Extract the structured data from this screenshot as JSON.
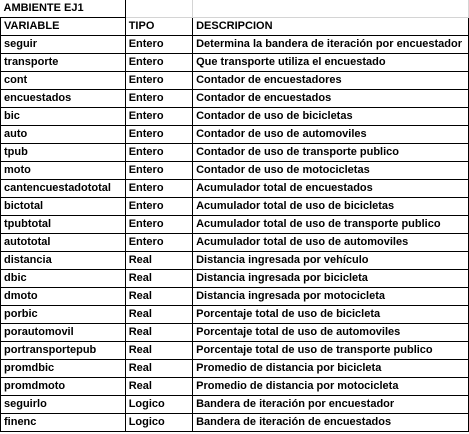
{
  "sheet": {
    "title": "AMBIENTE EJ1",
    "headers": [
      "VARIABLE",
      "TIPO",
      "DESCRIPCION"
    ],
    "rows": [
      [
        "seguir",
        "Entero",
        "Determina la bandera de iteración por encuestador"
      ],
      [
        "transporte",
        "Entero",
        "Que transporte utiliza el encuestado"
      ],
      [
        "cont",
        "Entero",
        "Contador de encuestadores"
      ],
      [
        "encuestados",
        "Entero",
        "Contador de encuestados"
      ],
      [
        "bic",
        "Entero",
        "Contador de uso de bicicletas"
      ],
      [
        "auto",
        "Entero",
        "Contador de uso de automoviles"
      ],
      [
        "tpub",
        "Entero",
        "Contador de uso de transporte publico"
      ],
      [
        "moto",
        "Entero",
        "Contador de uso de motocicletas"
      ],
      [
        "cantencuestadototal",
        "Entero",
        "Acumulador total de encuestados"
      ],
      [
        "bictotal",
        "Entero",
        "Acumulador total de uso de bicicletas"
      ],
      [
        "tpubtotal",
        "Entero",
        "Acumulador total de uso de transporte publico"
      ],
      [
        "autototal",
        "Entero",
        "Acumulador total de uso de automoviles"
      ],
      [
        "distancia",
        "Real",
        "Distancia ingresada por vehículo"
      ],
      [
        "dbic",
        "Real",
        "Distancia ingresada por bicicleta"
      ],
      [
        "dmoto",
        "Real",
        "Distancia ingresada por motocicleta"
      ],
      [
        "porbic",
        "Real",
        "Porcentaje total de uso de bicicleta"
      ],
      [
        "porautomovil",
        "Real",
        "Porcentaje total de uso de automoviles"
      ],
      [
        "portransportepub",
        "Real",
        "Porcentaje total de uso de transporte publico"
      ],
      [
        "promdbic",
        "Real",
        "Promedio de distancia por bicicleta"
      ],
      [
        "promdmoto",
        "Real",
        "Promedio de distancia por motocicleta"
      ],
      [
        "seguirlo",
        "Logico",
        "Bandera de iteración por encuestador"
      ],
      [
        "finenc",
        "Logico",
        "Bandera de iteración de encuestados"
      ]
    ]
  }
}
